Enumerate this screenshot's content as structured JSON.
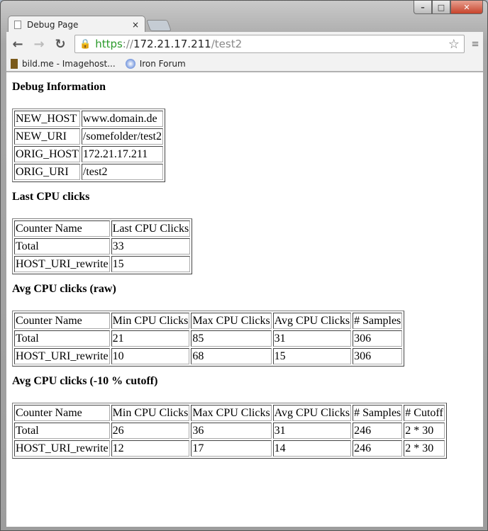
{
  "window": {
    "tab_title": "Debug Page",
    "url_scheme": "https",
    "url_host": "172.21.17.211",
    "url_path": "/test2"
  },
  "bookmarks": [
    "bild.me - Imagehost...",
    "Iron Forum"
  ],
  "sections": [
    {
      "title": "Debug Information",
      "rows": [
        [
          "NEW_HOST",
          "www.domain.de"
        ],
        [
          "NEW_URI",
          "/somefolder/test2"
        ],
        [
          "ORIG_HOST",
          "172.21.17.211"
        ],
        [
          "ORIG_URI",
          "/test2"
        ]
      ]
    },
    {
      "title": "Last CPU clicks",
      "rows": [
        [
          "Counter Name",
          "Last CPU Clicks"
        ],
        [
          "Total",
          "33"
        ],
        [
          "HOST_URI_rewrite",
          "15"
        ]
      ]
    },
    {
      "title": "Avg CPU clicks (raw)",
      "rows": [
        [
          "Counter Name",
          "Min CPU Clicks",
          "Max CPU Clicks",
          "Avg CPU Clicks",
          "# Samples"
        ],
        [
          "Total",
          "21",
          "85",
          "31",
          "306"
        ],
        [
          "HOST_URI_rewrite",
          "10",
          "68",
          "15",
          "306"
        ]
      ]
    },
    {
      "title": "Avg CPU clicks (-10 % cutoff)",
      "rows": [
        [
          "Counter Name",
          "Min CPU Clicks",
          "Max CPU Clicks",
          "Avg CPU Clicks",
          "# Samples",
          "# Cutoff"
        ],
        [
          "Total",
          "26",
          "36",
          "31",
          "246",
          "2 * 30"
        ],
        [
          "HOST_URI_rewrite",
          "12",
          "17",
          "14",
          "246",
          "2 * 30"
        ]
      ]
    }
  ]
}
